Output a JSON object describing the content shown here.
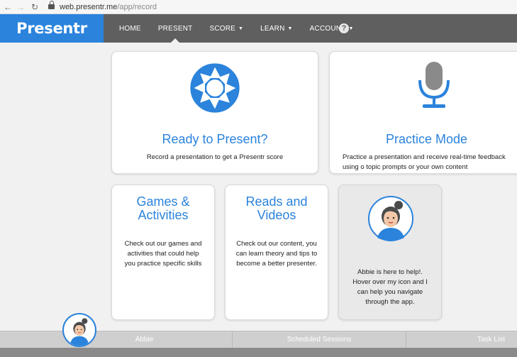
{
  "browser": {
    "url_host": "web.presentr.me",
    "url_path": "/app/record"
  },
  "navbar": {
    "brand": "Presentr",
    "items": [
      {
        "label": "HOME",
        "dropdown": false,
        "active": false
      },
      {
        "label": "PRESENT",
        "dropdown": false,
        "active": true
      },
      {
        "label": "SCORE",
        "dropdown": true,
        "active": false
      },
      {
        "label": "LEARN",
        "dropdown": true,
        "active": false
      },
      {
        "label": "ACCOUNT",
        "dropdown": true,
        "active": false
      }
    ],
    "help_symbol": "?",
    "caret": "▼"
  },
  "cards": {
    "present": {
      "icon": "camera-aperture-icon",
      "title": "Ready to Present?",
      "text": "Record a presentation to get a Presentr score"
    },
    "practice": {
      "icon": "microphone-icon",
      "title": "Practice Mode",
      "text": "Practice a presentation and receive real-time feedback using o topic prompts or your own content"
    },
    "games": {
      "title": "Games & Activities",
      "text": "Check out our games and activities that could help you practice specific skills"
    },
    "reads": {
      "title": "Reads and Videos",
      "text": "Check out our content, you can learn theory and tips to become a better presenter."
    },
    "abbie": {
      "icon": "abbie-avatar-icon",
      "text": "Abbie is here to help!. Hover over my icon and I can help you navigate through the app."
    }
  },
  "bottom_bar": {
    "items": [
      "Abbie",
      "Scheduled Sessions",
      "Task List"
    ]
  },
  "colors": {
    "brand_blue": "#2b83dc",
    "nav_gray": "#5f5f5f",
    "mic_gray": "#8a8a8a"
  }
}
